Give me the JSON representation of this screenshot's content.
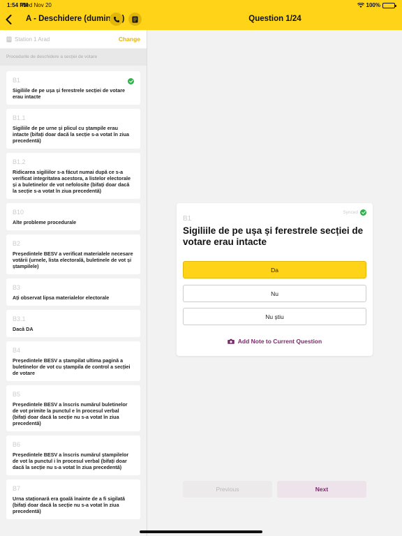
{
  "status_bar": {
    "time": "1:54 PM",
    "date": "Wed Nov 20",
    "battery": "100%"
  },
  "header": {
    "form_title": "A - Deschidere (duminică)",
    "question_counter": "Question 1/24"
  },
  "sidebar": {
    "station": "Station 1 Arad",
    "change_label": "Change",
    "section_title": "Procedurile de deschidere a secției de votare",
    "questions": [
      {
        "code": "B1",
        "text": "Sigiliile de pe ușa și ferestrele secției de votare erau intacte",
        "answered": true
      },
      {
        "code": "B1.1",
        "text": "Sigiliile de pe urne și plicul cu ștampile erau intacte (bifați doar dacă la secție s-a votat în ziua precedentă)",
        "answered": false
      },
      {
        "code": "B1.2",
        "text": "Ridicarea sigiliilor s-a făcut numai după ce s-a verificat integritatea acestora, a listelor electorale și a buletinelor de vot nefolosite (bifați doar dacă la secție s-a votat în ziua precedentă)",
        "answered": false
      },
      {
        "code": "B10",
        "text": "Alte probleme procedurale",
        "answered": false
      },
      {
        "code": "B2",
        "text": "Președintele BESV a verificat materialele necesare votării (urnele, lista electorală, buletinele de vot și ștampilele)",
        "answered": false
      },
      {
        "code": "B3",
        "text": "Ați observat lipsa materialelor electorale",
        "answered": false
      },
      {
        "code": "B3.1",
        "text": "Dacă DA",
        "answered": false
      },
      {
        "code": "B4",
        "text": "Președintele BESV a ștampilat ultima pagină a buletinelor de vot cu ștampila de control a secției de votare",
        "answered": false
      },
      {
        "code": "B5",
        "text": "Președintele BESV a înscris numărul buletinelor de vot primite la punctul e în procesul verbal (bifați doar dacă la secție nu s-a votat în ziua precedentă)",
        "answered": false
      },
      {
        "code": "B6",
        "text": "Președintele BESV a înscris numărul ștampilelor de vot la punctul i în procesul verbal (bifați doar dacă la secție nu s-a votat în ziua precedentă)",
        "answered": false
      },
      {
        "code": "B7",
        "text": "Urna staționară era goală înainte de a fi sigilată (bifați doar dacă la secție nu s-a votat în ziua precedentă)",
        "answered": false
      }
    ]
  },
  "question_card": {
    "synced_label": "Synced",
    "code": "B1",
    "text": "Sigiliile de pe ușa și ferestrele secției de votare erau intacte",
    "options": [
      {
        "label": "Da",
        "selected": true
      },
      {
        "label": "Nu",
        "selected": false
      },
      {
        "label": "Nu știu",
        "selected": false
      }
    ],
    "add_note_label": "Add Note to Current Question"
  },
  "navigation": {
    "previous_label": "Previous",
    "next_label": "Next"
  },
  "colors": {
    "accent": "#FFD418",
    "success": "#2db34a",
    "brand_purple": "#7a2a6a"
  }
}
